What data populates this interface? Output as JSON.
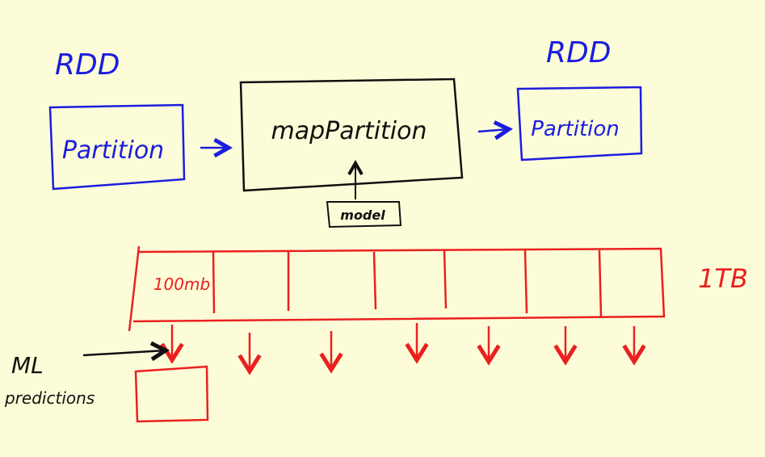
{
  "colors": {
    "background": "#fdfcd8",
    "blue": "#1b1de0",
    "black": "#111111",
    "red": "#ea2020"
  },
  "top": {
    "left_rdd_label": "RDD",
    "left_partition_label": "Partition",
    "map_partition_label": "mapPartition",
    "model_label": "model",
    "right_rdd_label": "RDD",
    "right_partition_label": "Partition"
  },
  "bottom": {
    "partition_size_label": "100mb",
    "total_size_label": "1TB",
    "ml_label": "ML",
    "predictions_label": "predictions"
  }
}
